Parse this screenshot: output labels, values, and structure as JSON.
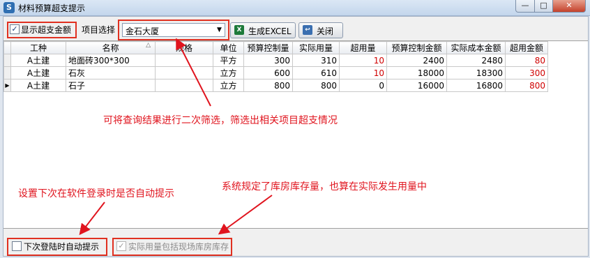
{
  "window": {
    "title": "材料预算超支提示",
    "app_icon": "S"
  },
  "toolbar": {
    "show_over_label": "显示超支金额",
    "show_over_checked": true,
    "project_label": "项目选择",
    "project_value": "金石大厦",
    "excel_button": "生成EXCEL",
    "close_button": "关闭"
  },
  "table": {
    "columns": [
      "工种",
      "名称",
      "规格",
      "单位",
      "预算控制量",
      "实际用量",
      "超用量",
      "预算控制金额",
      "实际成本金额",
      "超用金额"
    ],
    "rows": [
      {
        "trade": "A土建",
        "name": "地面砖300*300",
        "spec": "",
        "unit": "平方",
        "budget_qty": "300",
        "actual_qty": "310",
        "over_qty": "10",
        "budget_amt": "2400",
        "actual_amt": "2480",
        "over_amt": "80"
      },
      {
        "trade": "A土建",
        "name": "石灰",
        "spec": "",
        "unit": "立方",
        "budget_qty": "600",
        "actual_qty": "610",
        "over_qty": "10",
        "budget_amt": "18000",
        "actual_amt": "18300",
        "over_amt": "300"
      },
      {
        "trade": "A土建",
        "name": "石子",
        "spec": "",
        "unit": "立方",
        "budget_qty": "800",
        "actual_qty": "800",
        "over_qty": "0",
        "budget_amt": "16000",
        "actual_amt": "16800",
        "over_amt": "800"
      }
    ],
    "sort_indicator": "△",
    "current_row_marker": "▶"
  },
  "notes": {
    "filter": "可将查询结果进行二次筛选，筛选出相关项目超支情况",
    "auto_prompt": "设置下次在软件登录时是否自动提示",
    "stock": "系统规定了库房库存量，也算在实际发生用量中"
  },
  "bottom": {
    "next_login_label": "下次登陆时自动提示",
    "next_login_checked": false,
    "stock_label": "实际用量包括现场库房库存",
    "stock_checked": true
  },
  "colors": {
    "annotation": "#e0141e",
    "over_value": "#d00000"
  }
}
